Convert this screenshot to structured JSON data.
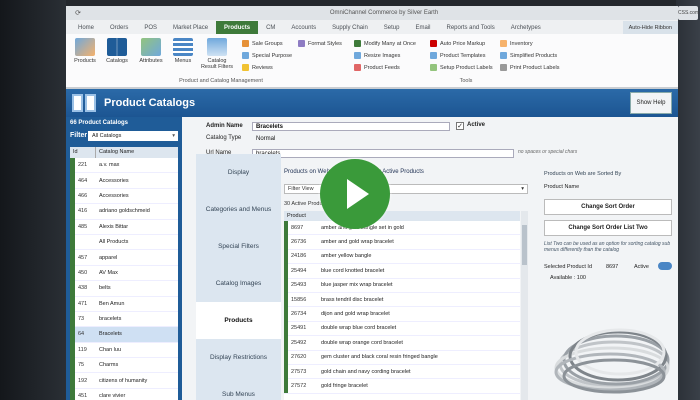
{
  "window": {
    "title": "OmniChannel Commerce by Silver Earth"
  },
  "tabs": [
    "Home",
    "Orders",
    "POS",
    "Market Place",
    "Products",
    "CM",
    "Accounts",
    "Supply Chain",
    "Setup",
    "Email",
    "Reports and Tools",
    "Archetypes"
  ],
  "active_tab": "Products",
  "auto_hide_label": "Auto-Hide Ribbon",
  "ribbon": {
    "big_buttons": [
      "Products",
      "Catalogs",
      "Attributes",
      "Menus",
      "Catalog Result Filters"
    ],
    "col1": [
      "Sale Groups",
      "Special Purpose",
      "Reviews"
    ],
    "format_styles": "Format Styles",
    "col2": [
      "Modify Many at Once",
      "Resize Images",
      "Product Feeds"
    ],
    "col3": [
      "Auto Price Markup",
      "Product Templates",
      "Setup Product Labels"
    ],
    "col4": [
      "Inventory",
      "Simplified Products",
      "Print Product Labels"
    ],
    "group_mgmt": "Product and Catalog Management",
    "group_tools": "Tools"
  },
  "panel_tab": "Catalogs",
  "app": {
    "title": "Product Catalogs",
    "show_help": "Show Help"
  },
  "sidebar": {
    "count": "66 Product Catalogs",
    "filter_label": "Filter",
    "filter_value": "All Catalogs",
    "col_id": "Id",
    "col_name": "Catalog Name",
    "rows": [
      {
        "id": "221",
        "name": "a.v. max"
      },
      {
        "id": "464",
        "name": "Accessories"
      },
      {
        "id": "466",
        "name": "Accessories"
      },
      {
        "id": "416",
        "name": "adriano goldschmeid"
      },
      {
        "id": "485",
        "name": "Alexis Bittar"
      },
      {
        "id": "",
        "name": "All Products"
      },
      {
        "id": "457",
        "name": "apparel"
      },
      {
        "id": "450",
        "name": "AV Max"
      },
      {
        "id": "438",
        "name": "belts"
      },
      {
        "id": "471",
        "name": "Ben Amun"
      },
      {
        "id": "73",
        "name": "bracelets"
      },
      {
        "id": "64",
        "name": "Bracelets"
      },
      {
        "id": "119",
        "name": "Chan luu"
      },
      {
        "id": "75",
        "name": "Charms"
      },
      {
        "id": "192",
        "name": "citizens of humanity"
      },
      {
        "id": "451",
        "name": "clare vivier"
      }
    ],
    "selected_index": 11
  },
  "form": {
    "admin_name_label": "Admin Name",
    "admin_name_value": "Bracelets",
    "active_label": "Active",
    "catalog_type_label": "Catalog Type",
    "catalog_type_value": "Normal",
    "url_name_label": "Url Name",
    "url_name_value": "bracelets",
    "url_hint": "no spaces or special chars"
  },
  "vtabs": [
    "Display",
    "Categories and Menus",
    "Special Filters",
    "Catalog Images",
    "Products",
    "Display Restrictions",
    "Sub Menus"
  ],
  "active_vtab": "Products",
  "products": {
    "on_web_label": "Products on Web",
    "view_label": "View Active Products",
    "filter_value": "Filter View",
    "active_count": "30 Active Products",
    "col_id": "Product",
    "rows": [
      {
        "id": "8697",
        "name": "amber and gold bangle set in gold"
      },
      {
        "id": "26736",
        "name": "amber and gold wrap bracelet"
      },
      {
        "id": "24186",
        "name": "amber yellow bangle"
      },
      {
        "id": "25494",
        "name": "blue cord knotted bracelet"
      },
      {
        "id": "25493",
        "name": "blue jasper mix wrap bracelet"
      },
      {
        "id": "15856",
        "name": "brass tendril disc bracelet"
      },
      {
        "id": "26734",
        "name": "dijon and gold wrap bracelet"
      },
      {
        "id": "25491",
        "name": "double wrap blue cord bracelet"
      },
      {
        "id": "25492",
        "name": "double wrap orange cord bracelet"
      },
      {
        "id": "27620",
        "name": "gem cluster and black coral resin fringed bangle"
      },
      {
        "id": "27573",
        "name": "gold chain and navy cording bracelet"
      },
      {
        "id": "27572",
        "name": "gold fringe bracelet"
      }
    ]
  },
  "right": {
    "sorted_label": "Products on Web are Sorted By",
    "sorted_value": "Product Name",
    "change_sort_order": "Change Sort Order",
    "change_sort_order_list_two": "Change Sort Order List Two",
    "list_two_note": "List Two can be used as an option for sorting catalog sub menus differently than the catalog",
    "selected_label": "Selected Product Id",
    "selected_value": "8697",
    "active_label": "Active",
    "available_label": "Available : 100"
  },
  "colors": {
    "accent_green": "#3e7a3a",
    "header_blue": "#1f5c98",
    "play_green": "#3a9a3a"
  },
  "right_edge_text": "CSS.com"
}
